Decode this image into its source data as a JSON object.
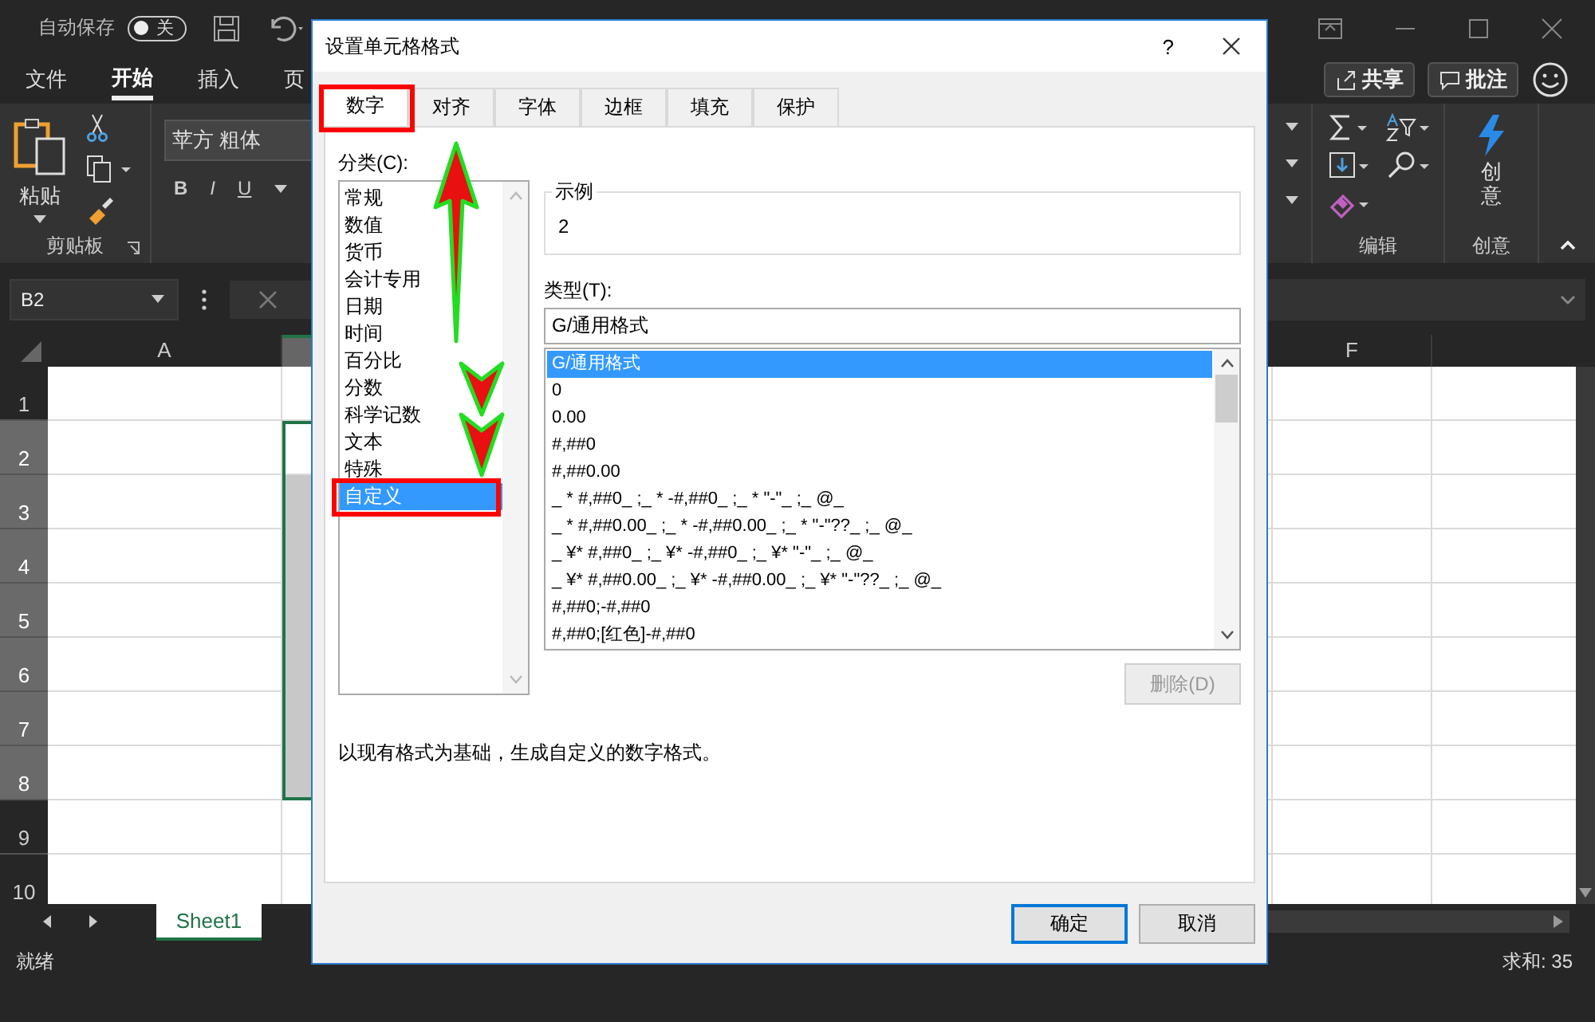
{
  "title_bar": {
    "autosave_label": "自动保存",
    "autosave_toggle": {
      "label": "关",
      "on": false
    }
  },
  "ribbon_tabs": [
    {
      "label": "文件",
      "selected": false
    },
    {
      "label": "开始",
      "selected": true
    },
    {
      "label": "插入",
      "selected": false
    },
    {
      "label": "页",
      "selected": false
    }
  ],
  "account_buttons": [
    {
      "label": "共享",
      "kind": "share"
    },
    {
      "label": "批注",
      "kind": "comment"
    }
  ],
  "clipboard_group": {
    "paste_label": "粘贴",
    "group_label": "剪贴板"
  },
  "font_group": {
    "font_name": "苹方 粗体",
    "format_buttons": [
      "B",
      "I",
      "U"
    ]
  },
  "editing_group": {
    "group_label": "编辑"
  },
  "ideas_group": {
    "button_label": "创意",
    "group_label": "创意"
  },
  "formula_bar": {
    "name_box": "B2"
  },
  "column_headers": [
    {
      "label": "A",
      "selected": false
    },
    {
      "label": "F",
      "selected": false
    }
  ],
  "row_headers": [
    {
      "label": "1",
      "selected": false
    },
    {
      "label": "2",
      "selected": true
    },
    {
      "label": "3",
      "selected": true
    },
    {
      "label": "4",
      "selected": true
    },
    {
      "label": "5",
      "selected": true
    },
    {
      "label": "6",
      "selected": true
    },
    {
      "label": "7",
      "selected": true
    },
    {
      "label": "8",
      "selected": true
    },
    {
      "label": "9",
      "selected": false
    },
    {
      "label": "10",
      "selected": false
    }
  ],
  "sheet_tabs": [
    {
      "label": "Sheet1",
      "selected": true
    }
  ],
  "status_bar": {
    "status": "就绪",
    "summary": "求和: 35"
  },
  "dialog": {
    "title": "设置单元格格式",
    "help": "?",
    "tabs": [
      {
        "label": "数字",
        "selected": true
      },
      {
        "label": "对齐",
        "selected": false
      },
      {
        "label": "字体",
        "selected": false
      },
      {
        "label": "边框",
        "selected": false
      },
      {
        "label": "填充",
        "selected": false
      },
      {
        "label": "保护",
        "selected": false
      }
    ],
    "category_label": "分类(C):",
    "categories": [
      {
        "label": "常规",
        "selected": false
      },
      {
        "label": "数值",
        "selected": false
      },
      {
        "label": "货币",
        "selected": false
      },
      {
        "label": "会计专用",
        "selected": false
      },
      {
        "label": "日期",
        "selected": false
      },
      {
        "label": "时间",
        "selected": false
      },
      {
        "label": "百分比",
        "selected": false
      },
      {
        "label": "分数",
        "selected": false
      },
      {
        "label": "科学记数",
        "selected": false
      },
      {
        "label": "文本",
        "selected": false
      },
      {
        "label": "特殊",
        "selected": false
      },
      {
        "label": "自定义",
        "selected": true
      }
    ],
    "sample_label": "示例",
    "sample_value": "2",
    "type_label": "类型(T):",
    "type_value": "G/通用格式",
    "types": [
      {
        "label": "G/通用格式",
        "selected": true
      },
      {
        "label": "0",
        "selected": false
      },
      {
        "label": "0.00",
        "selected": false
      },
      {
        "label": "#,##0",
        "selected": false
      },
      {
        "label": "#,##0.00",
        "selected": false
      },
      {
        "label": "_ * #,##0_ ;_ * -#,##0_ ;_ * \"-\"_ ;_ @_",
        "selected": false
      },
      {
        "label": "_ * #,##0.00_ ;_ * -#,##0.00_ ;_ * \"-\"??_ ;_ @_",
        "selected": false
      },
      {
        "label": "_ ¥* #,##0_ ;_ ¥* -#,##0_ ;_ ¥* \"-\"_ ;_ @_",
        "selected": false
      },
      {
        "label": "_ ¥* #,##0.00_ ;_ ¥* -#,##0.00_ ;_ ¥* \"-\"??_ ;_ @_",
        "selected": false
      },
      {
        "label": "#,##0;-#,##0",
        "selected": false
      },
      {
        "label": "#,##0;[红色]-#,##0",
        "selected": false
      }
    ],
    "delete_button": {
      "label": "删除(D)",
      "disabled": true
    },
    "description": "以现有格式为基础，生成自定义的数字格式。",
    "buttons": [
      {
        "label": "确定",
        "kind": "primary"
      },
      {
        "label": "取消",
        "kind": "secondary"
      }
    ]
  }
}
